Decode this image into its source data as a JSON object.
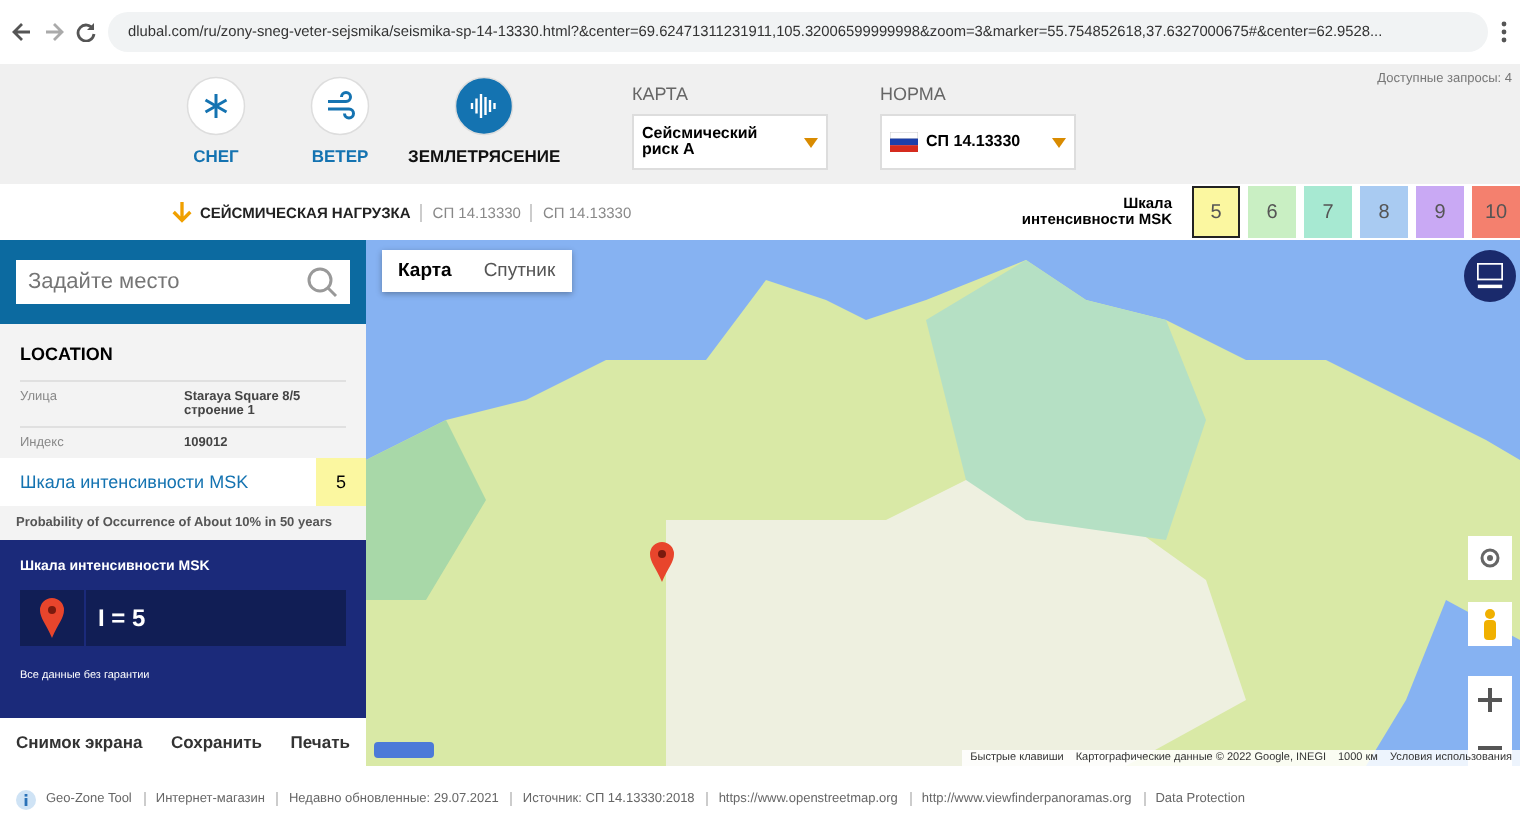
{
  "browser": {
    "url": "dlubal.com/ru/zony-sneg-veter-sejsmika/seismika-sp-14-13330.html?&center=69.62471311231911,105.32006599999998&zoom=3&marker=55.754852618,37.6327000675#&center=62.9528..."
  },
  "header": {
    "hazards": [
      {
        "kind": "snow",
        "label": "СНЕГ",
        "selected": false
      },
      {
        "kind": "wind",
        "label": "ВЕТЕР",
        "selected": false
      },
      {
        "kind": "quake",
        "label": "ЗЕМЛЕТРЯСЕНИЕ",
        "selected": true
      }
    ],
    "map_label": "КАРТА",
    "map_value": "Сейсмический риск А",
    "norm_label": "НОРМА",
    "norm_value": "СП 14.13330",
    "requests": "Доступные запросы: 4"
  },
  "subbar": {
    "breadcrumb": [
      "СЕЙСМИЧЕСКАЯ НАГРУЗКА",
      "СП 14.13330",
      "СП 14.13330"
    ],
    "scale_label": "Шкала интенсивности MSK",
    "scale": [
      {
        "label": "5",
        "color": "#fbf7a0",
        "selected": true
      },
      {
        "label": "6",
        "color": "#c9efc3",
        "selected": false
      },
      {
        "label": "7",
        "color": "#a7e9d2",
        "selected": false
      },
      {
        "label": "8",
        "color": "#a9cbf2",
        "selected": false
      },
      {
        "label": "9",
        "color": "#c9a9f4",
        "selected": false
      },
      {
        "label": "10",
        "color": "#f4806e",
        "selected": false
      }
    ]
  },
  "sidebar": {
    "search": {
      "placeholder": "Задайте место"
    },
    "location_title": "LOCATION",
    "fields": [
      {
        "label": "Улица",
        "value": "Staraya Square 8/5 строение 1"
      },
      {
        "label": "Индекс",
        "value": "109012"
      }
    ],
    "intensity": {
      "label": "Шкала интенсивности MSK",
      "value": "5",
      "color": "#fbf7a0"
    },
    "probability": "Probability of Occurrence of About 10% in 50 years",
    "result_title": "Шкала интенсивности MSK",
    "result": "I = 5",
    "disclaimer": "Все данные без гарантии",
    "actions": [
      "Снимок экрана",
      "Сохранить",
      "Печать"
    ]
  },
  "map": {
    "types": [
      {
        "label": "Карта",
        "selected": true
      },
      {
        "label": "Спутник",
        "selected": false
      }
    ],
    "attribution": [
      "Быстрые клавиши",
      "Картографические данные © 2022 Google, INEGI",
      "1000 км",
      "Условия использования"
    ]
  },
  "footer": [
    "Geo-Zone Tool",
    "Интернет-магазин",
    "Недавно обновленные: 29.07.2021",
    "Источник: СП 14.13330:2018",
    "https://www.openstreetmap.org",
    "http://www.viewfinderpanoramas.org",
    "Data Protection"
  ]
}
